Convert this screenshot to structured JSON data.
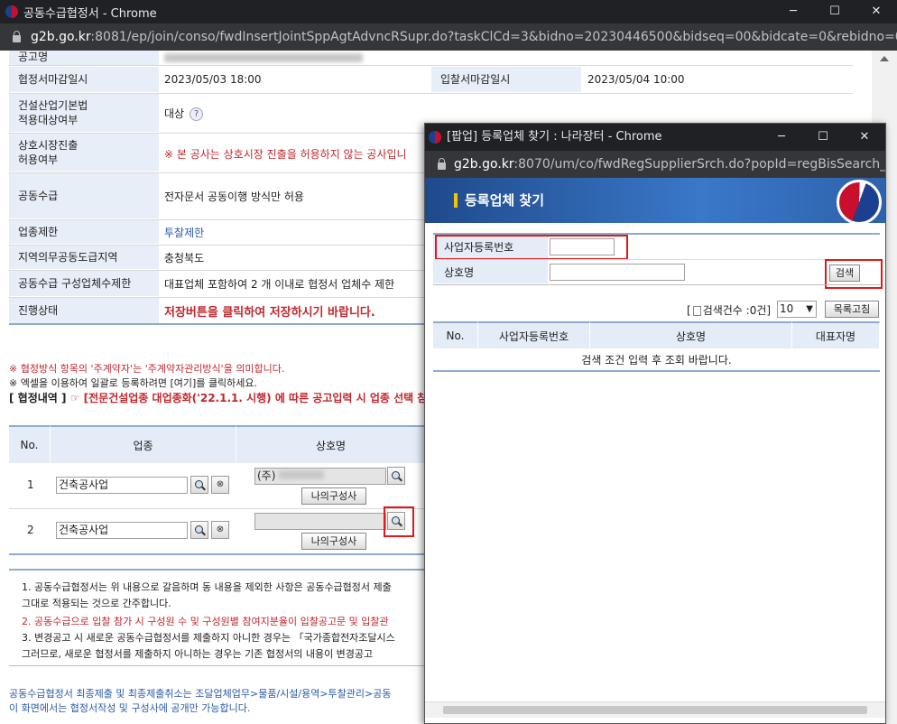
{
  "main_window": {
    "title": "공동수급협정서 - Chrome",
    "controls": {
      "minimize": "─",
      "maximize": "☐",
      "close": "✕"
    },
    "url_host": "g2b.go.kr",
    "url_rest": ":8081/ep/join/conso/fwdInsertJointSppAgtAdvncRSupr.do?taskClCd=3&bidno=20230446500&bidseq=00&bidcate=0&rebidno=0&from..."
  },
  "info": {
    "announce_name_label": "공고명",
    "agreement_deadline_label": "협정서마감일시",
    "agreement_deadline_value": "2023/05/03 18:00",
    "bid_deadline_label": "입찰서마감일시",
    "bid_deadline_value": "2023/05/04 10:00",
    "construction_act_label_1": "건설산업기본법",
    "construction_act_label_2": "적용대상여부",
    "construction_act_value": "대상",
    "help_icon": "?",
    "mutual_market_label_1": "상호시장진출",
    "mutual_market_label_2": "허용여부",
    "mutual_market_value": "※ 본 공사는 상호시장 진출을 허용하지 않는 공사입니",
    "joint_supply_label": "공동수급",
    "joint_supply_value": "전자문서 공동이행 방식만 허용",
    "industry_limit_label": "업종제한",
    "industry_limit_value": "투찰제한",
    "region_label": "지역의무공동도급지역",
    "region_value": "충청북도",
    "member_limit_label": "공동수급 구성업체수제한",
    "member_limit_value": "대표업체 포함하여 2 개 이내로 협정서 업체수 제한",
    "status_label": "진행상태",
    "status_value": "저장버튼을 클릭하여 저장하시기 바랍니다."
  },
  "notes": {
    "note1": "※ 협정방식 항목의 '주계약자'는 '주계약자관리방식'을 의미합니다.",
    "note2": "※ 엑셀을 이용하여 일괄로 등록하려면 [여기]를 클릭하세요.",
    "section_title": "[ 협정내역 ]",
    "section_notice": "☞ [전문건설업종 대업종화('22.1.1. 시행) 에 따른 공고입력 시 업종 선택 참고"
  },
  "list_table": {
    "headers": [
      "No.",
      "업종",
      "상호명"
    ],
    "rows": [
      {
        "no": "1",
        "industry": "건축공사업",
        "company": "(주)",
        "composer_btn": "나의구성사"
      },
      {
        "no": "2",
        "industry": "건축공사업",
        "company": "",
        "composer_btn": "나의구성사"
      }
    ],
    "delete_icon": "⊗"
  },
  "bottom_notes": {
    "n1a": "1. 공동수급협정서는 위 내용으로 갈음하며 동 내용을 제외한 사항은 공동수급협정서 제출",
    "n1b": "그대로 적용되는 것으로 간주합니다.",
    "n2": "2. 공동수급으로 입찰 참가 시 구성원 수 및 구성원별 참여지분율이 입찰공고문 및 입찰관",
    "n3a": "3. 변경공고 시 새로운 공동수급협정서를 제출하지 아니한 경우는 「국가종합전자조달시스",
    "n3b": "그러므로, 새로운 협정서를 제출하지 아니하는 경우는 기존 협정서의 내용이 변경공고"
  },
  "footer": {
    "line1": "공동수급협정서 최종제출 및 최종제출취소는 조달업체업무>물품/시설/용역>투찰관리>공동",
    "line2": "이 화면에서는 협정서작성 및 구성사에 공개만 가능합니다."
  },
  "popup": {
    "title": "[팝업] 등록업체 찾기 : 나라장터 - Chrome",
    "controls": {
      "minimize": "─",
      "maximize": "☐",
      "close": "✕"
    },
    "url_host": "g2b.go.kr",
    "url_rest": ":8070/um/co/fwdRegSupplierSrch.do?popId=regBisSearch_00...",
    "banner_title": "등록업체 찾기",
    "biz_no_label": "사업자등록번호",
    "biz_no_value": "",
    "company_label": "상호명",
    "company_value": "",
    "search_btn": "검색",
    "result_count": "검색건수 :0건]",
    "page_size": "10",
    "refresh_btn": "목록고침",
    "headers": [
      "No.",
      "사업자등록번호",
      "상호명",
      "대표자명"
    ],
    "empty_msg": "검색 조건 입력 후 조회 바랍니다."
  },
  "colors": {
    "label_bg": "#e8eef7",
    "header_bg": "#e4ecf7",
    "highlight_red": "#e0181b",
    "banner_blue": "#2d62ad"
  }
}
